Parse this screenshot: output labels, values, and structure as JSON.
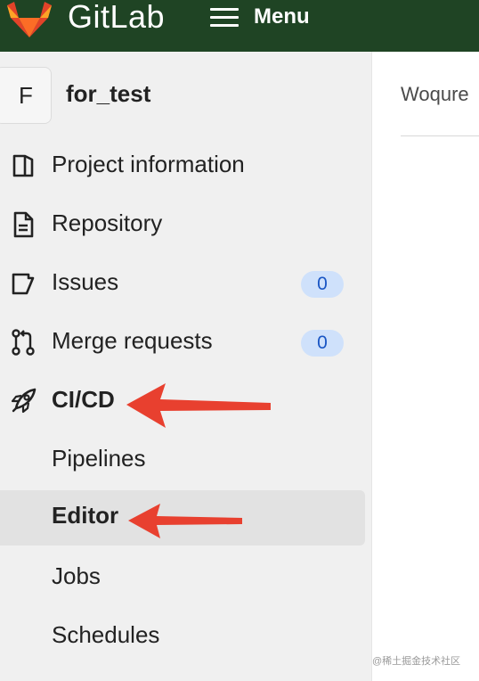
{
  "topbar": {
    "brand": "GitLab",
    "menu_label": "Menu"
  },
  "project": {
    "avatar_letter": "F",
    "name": "for_test"
  },
  "nav": {
    "items": [
      {
        "label": "Project information",
        "icon": "project-information-icon"
      },
      {
        "label": "Repository",
        "icon": "repository-icon"
      },
      {
        "label": "Issues",
        "icon": "issues-icon",
        "badge": "0"
      },
      {
        "label": "Merge requests",
        "icon": "merge-requests-icon",
        "badge": "0"
      },
      {
        "label": "CI/CD",
        "icon": "rocket-icon",
        "expanded": true
      }
    ],
    "cicd_subitems": [
      {
        "label": "Pipelines"
      },
      {
        "label": "Editor",
        "active": true
      },
      {
        "label": "Jobs"
      },
      {
        "label": "Schedules"
      }
    ]
  },
  "content": {
    "text": "Woqure"
  },
  "watermark": "@稀土掘金技术社区",
  "colors": {
    "topbar": "#1f4424",
    "sidebar": "#f0f0f0",
    "active_item": "#e2e2e2",
    "badge_bg": "#cfe1fb",
    "badge_text": "#1a56c4",
    "annotation_arrow": "#e8402f"
  }
}
